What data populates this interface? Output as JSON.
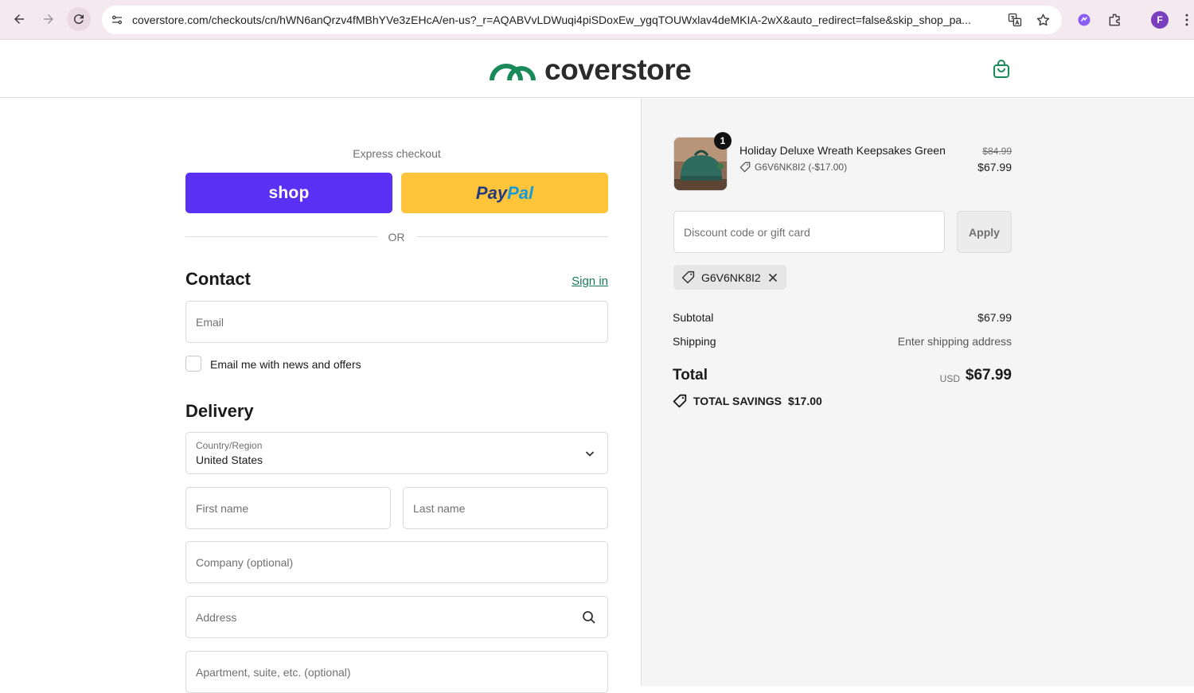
{
  "browser": {
    "url": "coverstore.com/checkouts/cn/hWN6anQrzv4fMBhYVe3zEHcA/en-us?_r=AQABVvLDWuqi4piSDoxEw_ygqTOUWxlav4deMKIA-2wX&auto_redirect=false&skip_shop_pa...",
    "profile_initial": "F"
  },
  "store": {
    "logo_text": "coverstore",
    "brand_color": "#1b8a5a"
  },
  "checkout": {
    "express_label": "Express checkout",
    "shop_label": "shop",
    "paypal_label_a": "Pay",
    "paypal_label_b": "Pal",
    "or_label": "OR",
    "contact_title": "Contact",
    "sign_in_label": "Sign in",
    "email_placeholder": "Email",
    "news_checkbox_label": "Email me with news and offers",
    "delivery_title": "Delivery",
    "country_label": "Country/Region",
    "country_value": "United States",
    "first_name_placeholder": "First name",
    "last_name_placeholder": "Last name",
    "company_placeholder": "Company (optional)",
    "address_placeholder": "Address",
    "apartment_placeholder": "Apartment, suite, etc. (optional)"
  },
  "summary": {
    "item": {
      "quantity": "1",
      "name": "Holiday Deluxe Wreath Keepsakes Green",
      "discount_code_line": "G6V6NK8I2 (-$17.00)",
      "original_price": "$84.99",
      "price": "$67.99"
    },
    "discount_placeholder": "Discount code or gift card",
    "apply_label": "Apply",
    "applied_code": "G6V6NK8I2",
    "subtotal_label": "Subtotal",
    "subtotal_value": "$67.99",
    "shipping_label": "Shipping",
    "shipping_value": "Enter shipping address",
    "total_label": "Total",
    "currency": "USD",
    "total_value": "$67.99",
    "savings_label": "TOTAL SAVINGS",
    "savings_value": "$17.00"
  }
}
